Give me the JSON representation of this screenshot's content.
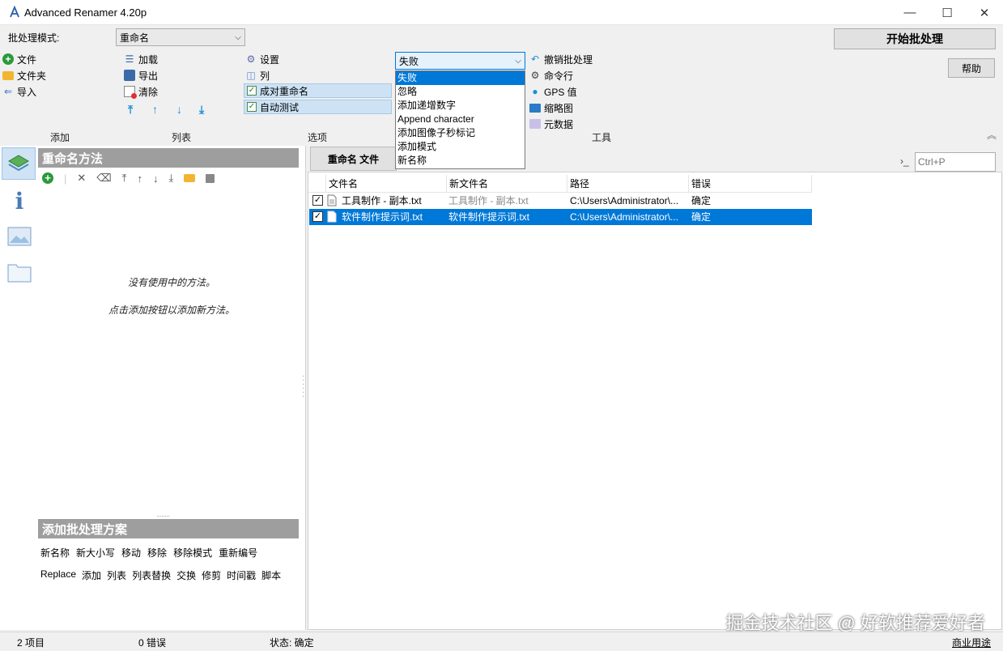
{
  "window": {
    "title": "Advanced Renamer 4.20p",
    "minimize": "—",
    "maximize": "☐",
    "close": "✕"
  },
  "toolbar": {
    "mode_label": "批处理模式:",
    "mode_value": "重命名",
    "add_group": {
      "file": "文件",
      "folder": "文件夹",
      "import": "导入",
      "group_label": "添加"
    },
    "list_group": {
      "load": "加载",
      "export": "导出",
      "clear": "清除",
      "group_label": "列表"
    },
    "options_group": {
      "settings": "设置",
      "columns": "列",
      "pair_rename": "成对重命名",
      "auto_test": "自动测试",
      "group_label": "选项"
    },
    "filter_value": "失败",
    "tools_group": {
      "undo": "撤销批处理",
      "cmdline": "命令行",
      "gps": "GPS 值",
      "thumbnail": "缩略图",
      "metadata": "元数据",
      "group_label": "工具"
    },
    "start_button": "开始批处理",
    "help_button": "帮助"
  },
  "dropdown": {
    "options": [
      "失败",
      "忽略",
      "添加递增数字",
      "Append character",
      "添加图像子秒标记",
      "添加模式",
      "新名称"
    ],
    "selected_index": 0
  },
  "left_panel": {
    "methods_header": "重命名方法",
    "empty_line1": "没有使用中的方法。",
    "empty_line2": "点击添加按钮以添加新方法。",
    "presets_header": "添加批处理方案",
    "presets_row1": [
      "新名称",
      "新大小写",
      "移动",
      "移除",
      "移除模式",
      "重新编号"
    ],
    "presets_row2": [
      "Replace",
      "添加",
      "列表",
      "列表替换",
      "交换",
      "修剪",
      "时间戳",
      "脚本"
    ]
  },
  "right_panel": {
    "tab_label": "重命名 文件",
    "search_placeholder": "Ctrl+P",
    "prompt_icon": "›_",
    "columns": [
      "文件名",
      "新文件名",
      "路径",
      "错误"
    ],
    "rows": [
      {
        "checked": true,
        "filename": "工具制作 - 副本.txt",
        "new_filename": "工具制作 - 副本.txt",
        "path": "C:\\Users\\Administrator\\...",
        "error": "确定",
        "selected": false
      },
      {
        "checked": true,
        "filename": "软件制作提示词.txt",
        "new_filename": "软件制作提示词.txt",
        "path": "C:\\Users\\Administrator\\...",
        "error": "确定",
        "selected": true
      }
    ]
  },
  "status": {
    "items": "2 项目",
    "errors": "0 错误",
    "state": "状态: 确定",
    "license": "商业用途"
  },
  "watermark": "掘金技术社区 @ 好软推荐爱好者",
  "colors": {
    "accent": "#0078d7",
    "header_gray": "#9e9e9e",
    "highlight": "#cde3f5",
    "arrow": "#1a8fd6"
  }
}
